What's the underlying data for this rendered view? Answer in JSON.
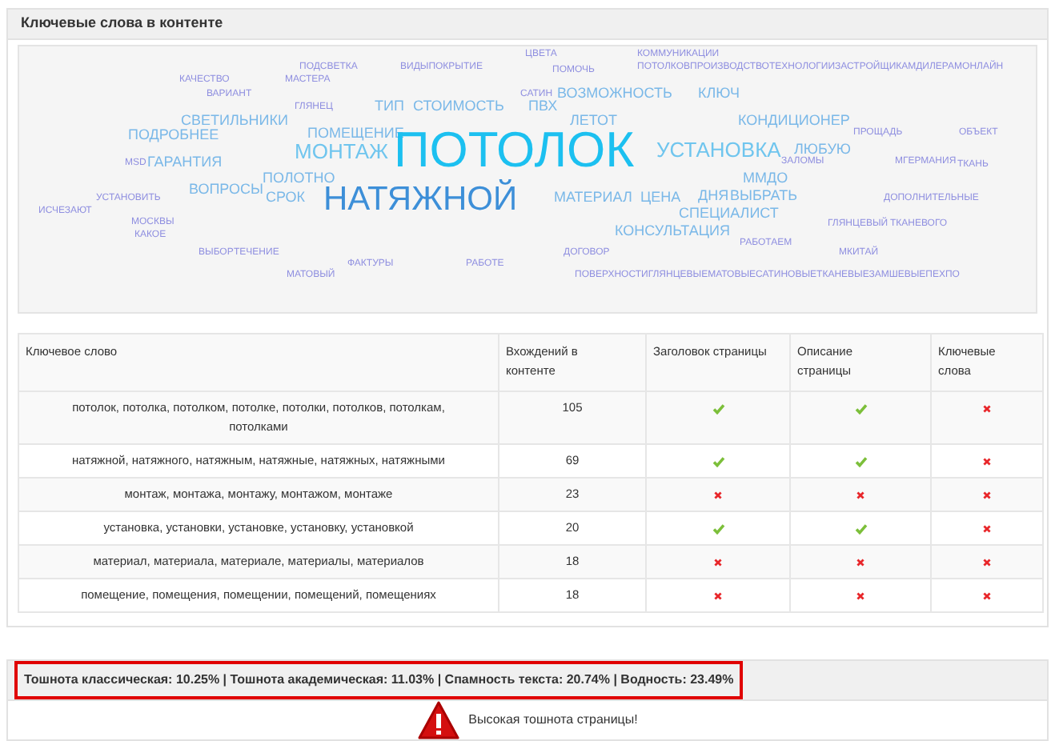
{
  "panel": {
    "title": "Ключевые слова в контенте"
  },
  "word_cloud": [
    {
      "text": "ЦВЕТА",
      "kind": "small"
    },
    {
      "text": "КОММУНИКАЦИИ",
      "kind": "small"
    },
    {
      "text": "ПОДСВЕТКА",
      "kind": "small"
    },
    {
      "text": "ВИДЫПОКРЫТИЕ",
      "kind": "small"
    },
    {
      "text": "ПОМОЧЬ",
      "kind": "small"
    },
    {
      "text": "ПОТОЛКОВПРОИЗВОДСТВОТЕХНОЛОГИИЗАСТРОЙЩИКАМДИЛЕРАМОНЛАЙН",
      "kind": "small"
    },
    {
      "text": "КАЧЕСТВО",
      "kind": "small"
    },
    {
      "text": "МАСТЕРА",
      "kind": "small"
    },
    {
      "text": "ВАРИАНТ",
      "kind": "small"
    },
    {
      "text": "САТИН",
      "kind": "small"
    },
    {
      "text": "ВОЗМОЖНОСТЬ",
      "kind": "medium"
    },
    {
      "text": "КЛЮЧ",
      "kind": "medium"
    },
    {
      "text": "ГЛЯНЕЦ",
      "kind": "small"
    },
    {
      "text": "ТИП",
      "kind": "medium"
    },
    {
      "text": "СТОИМОСТЬ",
      "kind": "medium"
    },
    {
      "text": "ПВХ",
      "kind": "medium"
    },
    {
      "text": "СВЕТИЛЬНИКИ",
      "kind": "medium"
    },
    {
      "text": "ЛЕТОТ",
      "kind": "medium"
    },
    {
      "text": "КОНДИЦИОНЕР",
      "kind": "medium"
    },
    {
      "text": "ПОДРОБНЕЕ",
      "kind": "medium"
    },
    {
      "text": "ПОМЕЩЕНИЕ",
      "kind": "medium"
    },
    {
      "text": "ПРОЩАДЬ",
      "kind": "small"
    },
    {
      "text": "ОБЪЕКТ",
      "kind": "small"
    },
    {
      "text": "МОНТАЖ",
      "kind": "large"
    },
    {
      "text": "ПОТОЛОК",
      "kind": "main"
    },
    {
      "text": "УСТАНОВКА",
      "kind": "large"
    },
    {
      "text": "ЛЮБУЮ",
      "kind": "medium"
    },
    {
      "text": "MSD",
      "kind": "small"
    },
    {
      "text": "ГАРАНТИЯ",
      "kind": "medium"
    },
    {
      "text": "ЗАЛОМЫ",
      "kind": "small"
    },
    {
      "text": "МГЕРМАНИЯ",
      "kind": "small"
    },
    {
      "text": "ТКАНЬ",
      "kind": "small"
    },
    {
      "text": "ПОЛОТНО",
      "kind": "medium"
    },
    {
      "text": "ММДО",
      "kind": "medium"
    },
    {
      "text": "ВОПРОСЫ",
      "kind": "medium"
    },
    {
      "text": "УСТАНОВИТЬ",
      "kind": "small"
    },
    {
      "text": "СРОК",
      "kind": "medium"
    },
    {
      "text": "НАТЯЖНОЙ",
      "kind": "second"
    },
    {
      "text": "МАТЕРИАЛ",
      "kind": "medium"
    },
    {
      "text": "ЦЕНА",
      "kind": "medium"
    },
    {
      "text": "ДНЯ",
      "kind": "medium"
    },
    {
      "text": "ВЫБРАТЬ",
      "kind": "medium"
    },
    {
      "text": "ДОПОЛНИТЕЛЬНЫЕ",
      "kind": "small"
    },
    {
      "text": "ИСЧЕЗАЮТ",
      "kind": "small"
    },
    {
      "text": "СПЕЦИАЛИСТ",
      "kind": "medium"
    },
    {
      "text": "МОСКВЫ",
      "kind": "small"
    },
    {
      "text": "ГЛЯНЦЕВЫЙ",
      "kind": "small"
    },
    {
      "text": "ТКАНЕВОГО",
      "kind": "small"
    },
    {
      "text": "КАКОЕ",
      "kind": "small"
    },
    {
      "text": "КОНСУЛЬТАЦИЯ",
      "kind": "medium"
    },
    {
      "text": "РАБОТАЕМ",
      "kind": "small"
    },
    {
      "text": "ВЫБОР",
      "kind": "small"
    },
    {
      "text": "ТЕЧЕНИЕ",
      "kind": "small"
    },
    {
      "text": "ДОГОВОР",
      "kind": "small"
    },
    {
      "text": "МКИТАЙ",
      "kind": "small"
    },
    {
      "text": "ФАКТУРЫ",
      "kind": "small"
    },
    {
      "text": "РАБОТЕ",
      "kind": "small"
    },
    {
      "text": "МАТОВЫЙ",
      "kind": "small"
    },
    {
      "text": "ПОВЕРХНОСТИГЛЯНЦЕВЫЕМАТОВЫЕСАТИНОВЫЕТКАНЕВЫЕЗАМШЕВЫЕПЕХПО",
      "kind": "small"
    }
  ],
  "table": {
    "columns": [
      "Ключевое слово",
      "Вхождений в контенте",
      "Заголовок страницы",
      "Описание страницы",
      "Ключевые слова"
    ],
    "rows": [
      {
        "keyword": "потолок, потолка, потолком, потолке, потолки, потолков, потолкам, потолками",
        "count": "105",
        "in_title": true,
        "in_description": true,
        "in_keywords": false
      },
      {
        "keyword": "натяжной, натяжного, натяжным, натяжные, натяжных, натяжными",
        "count": "69",
        "in_title": true,
        "in_description": true,
        "in_keywords": false
      },
      {
        "keyword": "монтаж, монтажа, монтажу, монтажом, монтаже",
        "count": "23",
        "in_title": false,
        "in_description": false,
        "in_keywords": false
      },
      {
        "keyword": "установка, установки, установке, установку, установкой",
        "count": "20",
        "in_title": true,
        "in_description": true,
        "in_keywords": false
      },
      {
        "keyword": "материал, материала, материале, материалы, материалов",
        "count": "18",
        "in_title": false,
        "in_description": false,
        "in_keywords": false
      },
      {
        "keyword": "помещение, помещения, помещении, помещений, помещениях",
        "count": "18",
        "in_title": false,
        "in_description": false,
        "in_keywords": false
      }
    ]
  },
  "summary": {
    "text": "Тошнота классическая: 10.25% | Тошнота академическая: 11.03% | Спамность текста: 20.74% | Водность: 23.49%",
    "highlighted": true
  },
  "warning": {
    "text": "Высокая тошнота страницы!"
  }
}
